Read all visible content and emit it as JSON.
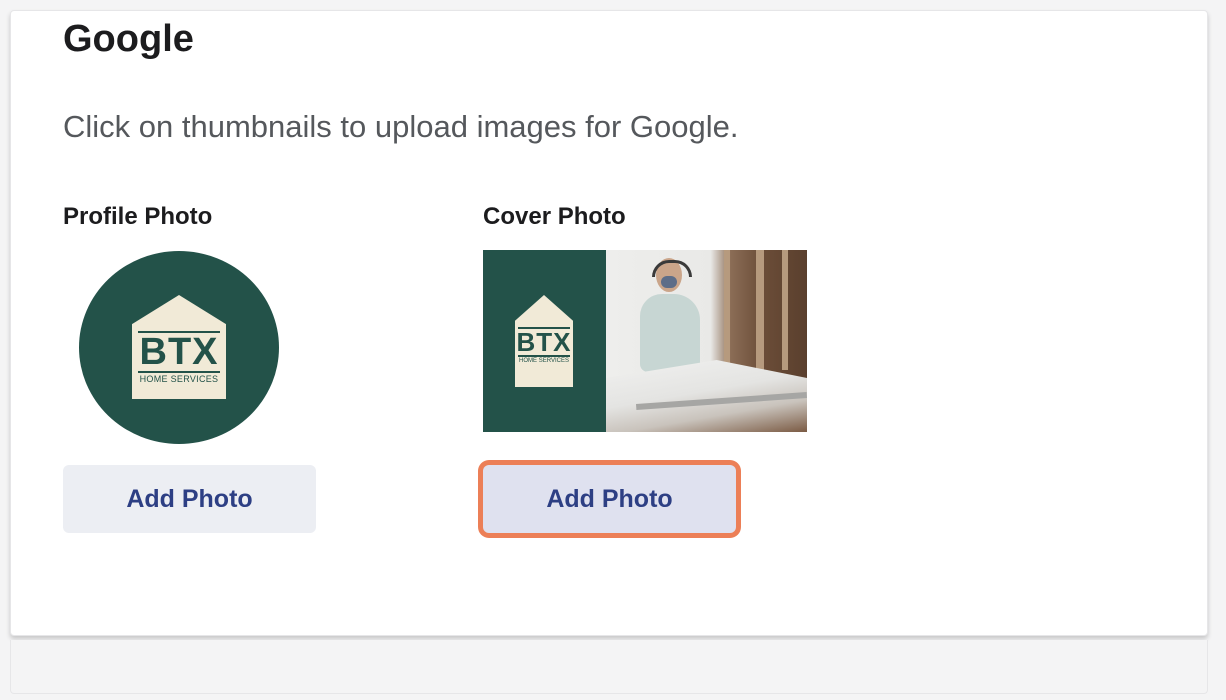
{
  "section": {
    "title": "Google",
    "description": "Click on thumbnails to upload images for Google."
  },
  "profile_photo": {
    "label": "Profile Photo",
    "logo_text": "BTX",
    "logo_subtext": "HOME SERVICES",
    "button_label": "Add Photo"
  },
  "cover_photo": {
    "label": "Cover Photo",
    "logo_text": "BTX",
    "logo_subtext": "HOME SERVICES",
    "button_label": "Add Photo"
  },
  "colors": {
    "brand_green": "#235249",
    "logo_cream": "#f1ead7",
    "button_text": "#2d3f84",
    "highlight": "#ec7f57"
  }
}
